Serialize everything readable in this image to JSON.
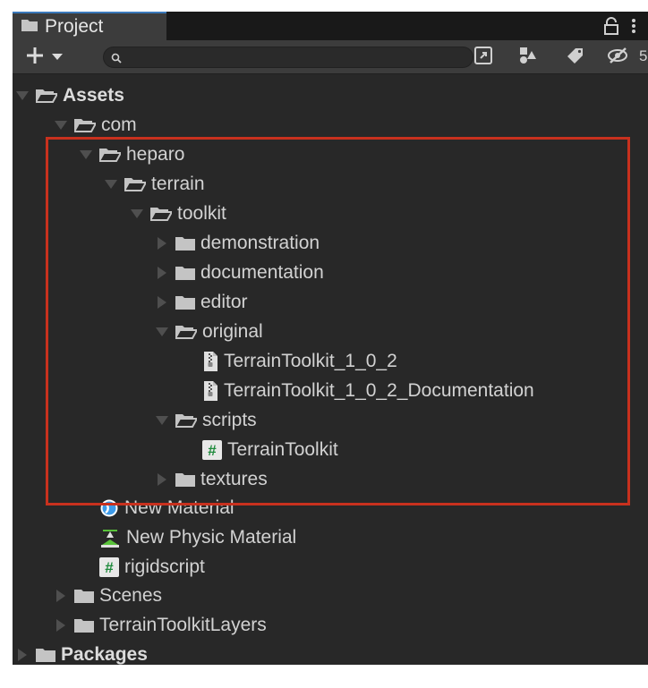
{
  "tab": {
    "label": "Project",
    "icon": "folder-icon"
  },
  "toolbar": {
    "create_icon": "plus-icon",
    "search": {
      "placeholder": "",
      "value": ""
    },
    "hidden_count": "5"
  },
  "colors": {
    "panel_bg": "#282828",
    "tab_accent": "#3a79bb",
    "highlight_box": "#c8311e",
    "csharp_icon_bg": "#e8e8e8",
    "csharp_hash": "#1e8a3c",
    "material_blue": "#3d9ae8",
    "physic_green": "#59c23a"
  },
  "tree": [
    {
      "label": "Assets",
      "state": "expanded",
      "icon": "folder-open-icon",
      "bold": true
    },
    {
      "label": "com",
      "state": "expanded",
      "icon": "folder-open-icon"
    },
    {
      "label": "heparo",
      "state": "expanded",
      "icon": "folder-open-icon"
    },
    {
      "label": "terrain",
      "state": "expanded",
      "icon": "folder-open-icon"
    },
    {
      "label": "toolkit",
      "state": "expanded",
      "icon": "folder-open-icon"
    },
    {
      "label": "demonstration",
      "state": "collapsed",
      "icon": "folder-icon"
    },
    {
      "label": "documentation",
      "state": "collapsed",
      "icon": "folder-icon"
    },
    {
      "label": "editor",
      "state": "collapsed",
      "icon": "folder-icon"
    },
    {
      "label": "original",
      "state": "expanded",
      "icon": "folder-open-icon"
    },
    {
      "label": "TerrainToolkit_1_0_2",
      "state": "none",
      "icon": "zip-file-icon"
    },
    {
      "label": "TerrainToolkit_1_0_2_Documentation",
      "state": "none",
      "icon": "zip-file-icon"
    },
    {
      "label": "scripts",
      "state": "expanded",
      "icon": "folder-open-icon"
    },
    {
      "label": "TerrainToolkit",
      "state": "none",
      "icon": "csharp-script-icon"
    },
    {
      "label": "textures",
      "state": "collapsed",
      "icon": "folder-icon"
    },
    {
      "label": "New Material",
      "state": "none",
      "icon": "material-icon"
    },
    {
      "label": "New Physic Material",
      "state": "none",
      "icon": "physic-material-icon"
    },
    {
      "label": "rigidscript",
      "state": "none",
      "icon": "csharp-script-icon"
    },
    {
      "label": "Scenes",
      "state": "collapsed",
      "icon": "folder-icon"
    },
    {
      "label": "TerrainToolkitLayers",
      "state": "collapsed",
      "icon": "folder-icon"
    },
    {
      "label": "Packages",
      "state": "collapsed",
      "icon": "folder-icon",
      "bold": true
    }
  ]
}
